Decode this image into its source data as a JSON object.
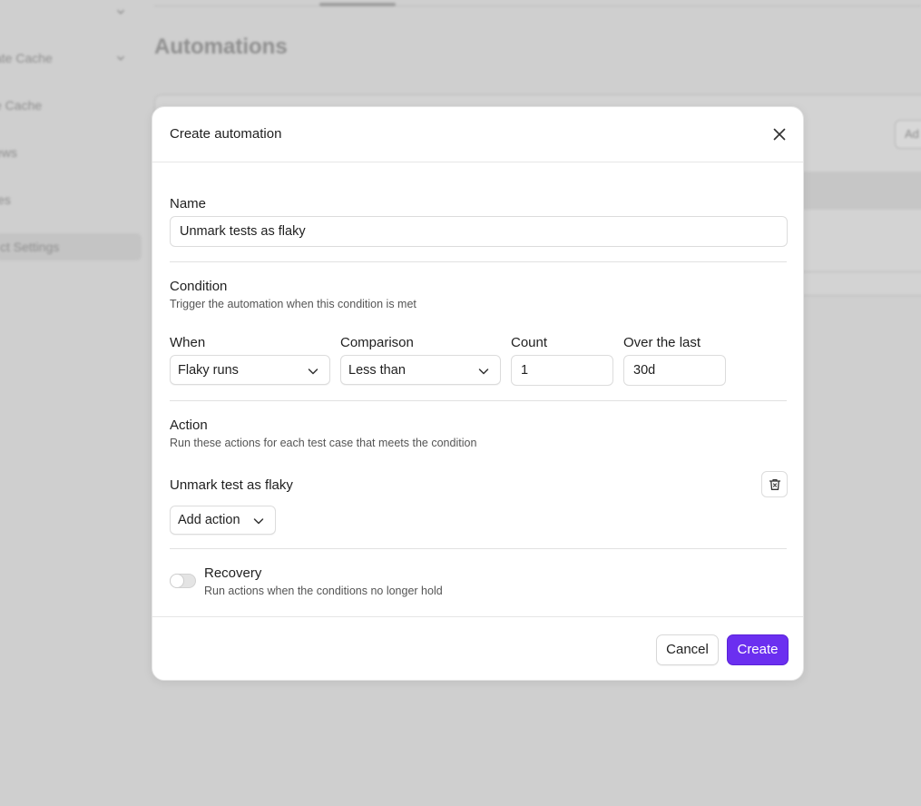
{
  "colors": {
    "accent": "#6b2ff0",
    "overlay": "#cfcfcf",
    "modal_bg": "#ffffff"
  },
  "background": {
    "sidebar_items": [
      {
        "label": ""
      },
      {
        "label": "ate Cache"
      },
      {
        "label": "e Cache"
      },
      {
        "label": "ews"
      },
      {
        "label": "les"
      },
      {
        "label": "ct Settings"
      }
    ],
    "page_title": "Automations",
    "card_button": "Ad"
  },
  "modal": {
    "title": "Create automation",
    "close_icon": "close-icon",
    "name": {
      "label": "Name",
      "value": "Unmark tests as flaky"
    },
    "condition": {
      "heading": "Condition",
      "description": "Trigger the automation when this condition is met",
      "when": {
        "label": "When",
        "selected": "Flaky runs"
      },
      "comparison": {
        "label": "Comparison",
        "selected": "Less than"
      },
      "count": {
        "label": "Count",
        "value": "1"
      },
      "over_the_last": {
        "label": "Over the last",
        "value": "30d"
      }
    },
    "action": {
      "heading": "Action",
      "description": "Run these actions for each test case that meets the condition",
      "item_label": "Unmark test as flaky",
      "delete_icon": "trash-icon",
      "add_action_label": "Add action"
    },
    "recovery": {
      "label": "Recovery",
      "description": "Run actions when the conditions no longer hold",
      "enabled": false
    },
    "footer": {
      "cancel_label": "Cancel",
      "create_label": "Create"
    }
  }
}
